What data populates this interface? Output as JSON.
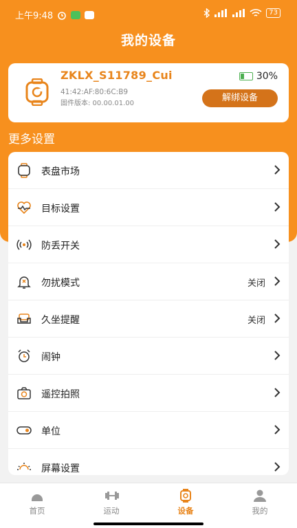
{
  "status_bar": {
    "time": "上午9:48",
    "battery": "73"
  },
  "header": {
    "title": "我的设备"
  },
  "device": {
    "name": "ZKLX_S11789_Cui",
    "mac": "41:42:AF:80:6C:B9",
    "firmware": "固件版本: 00.00.01.00",
    "battery": "30%",
    "unbind_label": "解绑设备"
  },
  "settings": {
    "section_title": "更多设置",
    "items": [
      {
        "label": "表盘市场",
        "value": "",
        "icon": "watch-face-icon"
      },
      {
        "label": "目标设置",
        "value": "",
        "icon": "heart-rate-icon"
      },
      {
        "label": "防丢开关",
        "value": "",
        "icon": "signal-icon"
      },
      {
        "label": "勿扰模式",
        "value": "关闭",
        "icon": "bell-off-icon"
      },
      {
        "label": "久坐提醒",
        "value": "关闭",
        "icon": "sofa-icon"
      },
      {
        "label": "闹钟",
        "value": "",
        "icon": "alarm-clock-icon"
      },
      {
        "label": "遥控拍照",
        "value": "",
        "icon": "camera-icon"
      },
      {
        "label": "单位",
        "value": "",
        "icon": "toggle-icon"
      },
      {
        "label": "屏幕设置",
        "value": "",
        "icon": "brightness-icon"
      }
    ]
  },
  "tabs": [
    {
      "label": "首页",
      "icon": "home-icon"
    },
    {
      "label": "运动",
      "icon": "dumbbell-icon"
    },
    {
      "label": "设备",
      "icon": "watch-icon"
    },
    {
      "label": "我的",
      "icon": "user-icon"
    }
  ],
  "colors": {
    "accent": "#f7901e",
    "button": "#d4731a",
    "active_tab": "#e8841a"
  }
}
